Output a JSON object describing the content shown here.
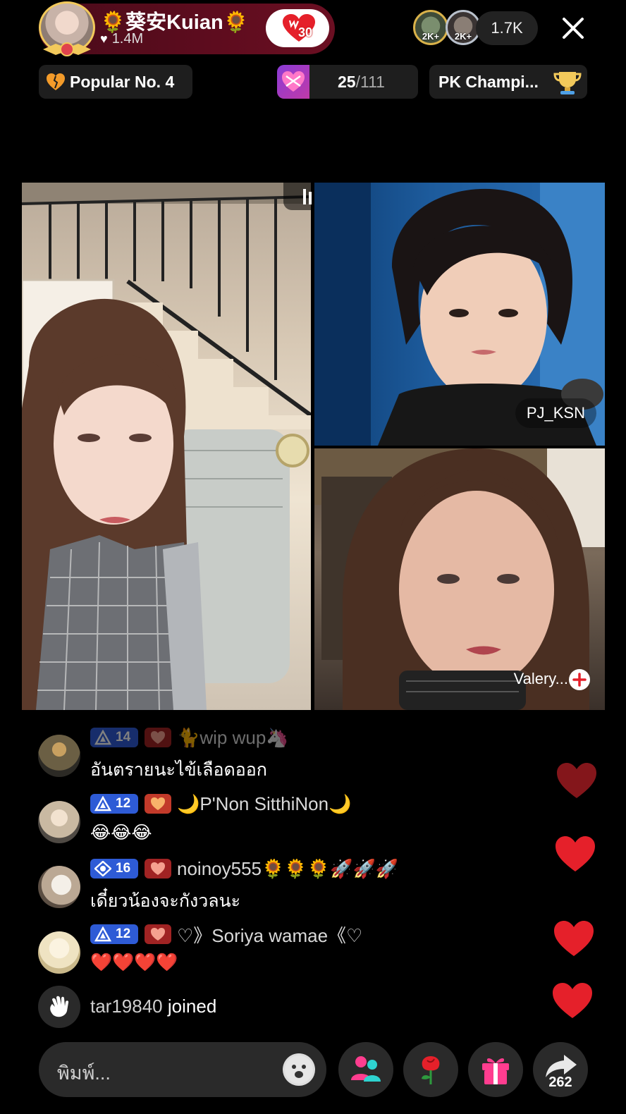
{
  "header": {
    "host_name": "🌻葵安Kuian🌻",
    "host_likes": "1.4M",
    "follow_count": "30",
    "top_viewers": [
      {
        "badge": "2K+"
      },
      {
        "badge": "2K+"
      }
    ],
    "viewer_count": "1.7K"
  },
  "chips": {
    "popular": "Popular No. 4",
    "score_main": "25",
    "score_total": "/111",
    "pk": "PK Champi..."
  },
  "tiles": {
    "guest1": "PJ_KSN",
    "guest2": "Valery..."
  },
  "chat": [
    {
      "level": "14",
      "name": "🐈wip wup🦄",
      "text": "อันตรายนะไข้เลือดออก",
      "avatar_color": "#6b5f44"
    },
    {
      "level": "12",
      "name": "🌙P'Non SitthiNon🌙",
      "text": "😂😂😂",
      "avatar_color": "#c9b9a2"
    },
    {
      "level": "16",
      "name": "noinoy555🌻🌻🌻🚀🚀🚀",
      "text": "เดี๋ยวน้องจะกังวลนะ",
      "avatar_color": "#bba894"
    },
    {
      "level": "12",
      "name": "♡》Soriya wamae《♡",
      "text": "❤️❤️❤️❤️",
      "avatar_color": "#efe3c2"
    }
  ],
  "join": {
    "user": "tar19840",
    "action": "joined"
  },
  "bottom": {
    "comment_placeholder": "พิมพ์...",
    "share_count": "262"
  },
  "colors": {
    "accent_red": "#e5202a",
    "level_blue": "#2e5bd6",
    "fan_red": "#a02323"
  }
}
